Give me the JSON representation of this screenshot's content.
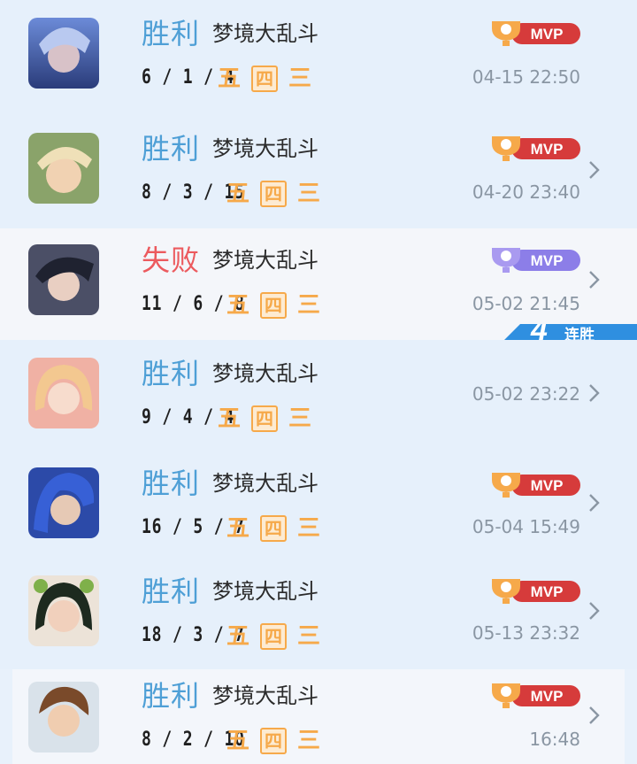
{
  "matches": [
    {
      "result": "胜利",
      "mode": "梦境大乱斗",
      "kda": "6 / 1 / 4",
      "mvp": "MVP",
      "time": "04-15 22:50"
    },
    {
      "result": "胜利",
      "mode": "梦境大乱斗",
      "kda": "8 / 3 / 15",
      "mvp": "MVP",
      "time": "04-20 23:40"
    },
    {
      "result": "失败",
      "mode": "梦境大乱斗",
      "kda": "11 / 6 / 8",
      "mvp": "MVP",
      "time": "05-02 21:45"
    },
    {
      "result": "胜利",
      "mode": "梦境大乱斗",
      "kda": "9 / 4 / 4",
      "time": "05-02 23:22"
    },
    {
      "result": "胜利",
      "mode": "梦境大乱斗",
      "kda": "16 / 5 / 7",
      "mvp": "MVP",
      "time": "05-04 15:49"
    },
    {
      "result": "胜利",
      "mode": "梦境大乱斗",
      "kda": "18 / 3 / 7",
      "mvp": "MVP",
      "time": "05-13 23:32"
    },
    {
      "result": "胜利",
      "mode": "梦境大乱斗",
      "kda": "8 / 2 / 10",
      "mvp": "MVP",
      "time": "16:48"
    }
  ],
  "badges": [
    "五",
    "四",
    "三"
  ],
  "streak": {
    "count": "4",
    "label": "连胜"
  },
  "colors": {
    "win": "#4e9fd6",
    "loss": "#ec5a5e",
    "badge": "#f6a94a",
    "mvp_gold": "#d63b3b",
    "mvp_purple": "#8c7ee8"
  }
}
